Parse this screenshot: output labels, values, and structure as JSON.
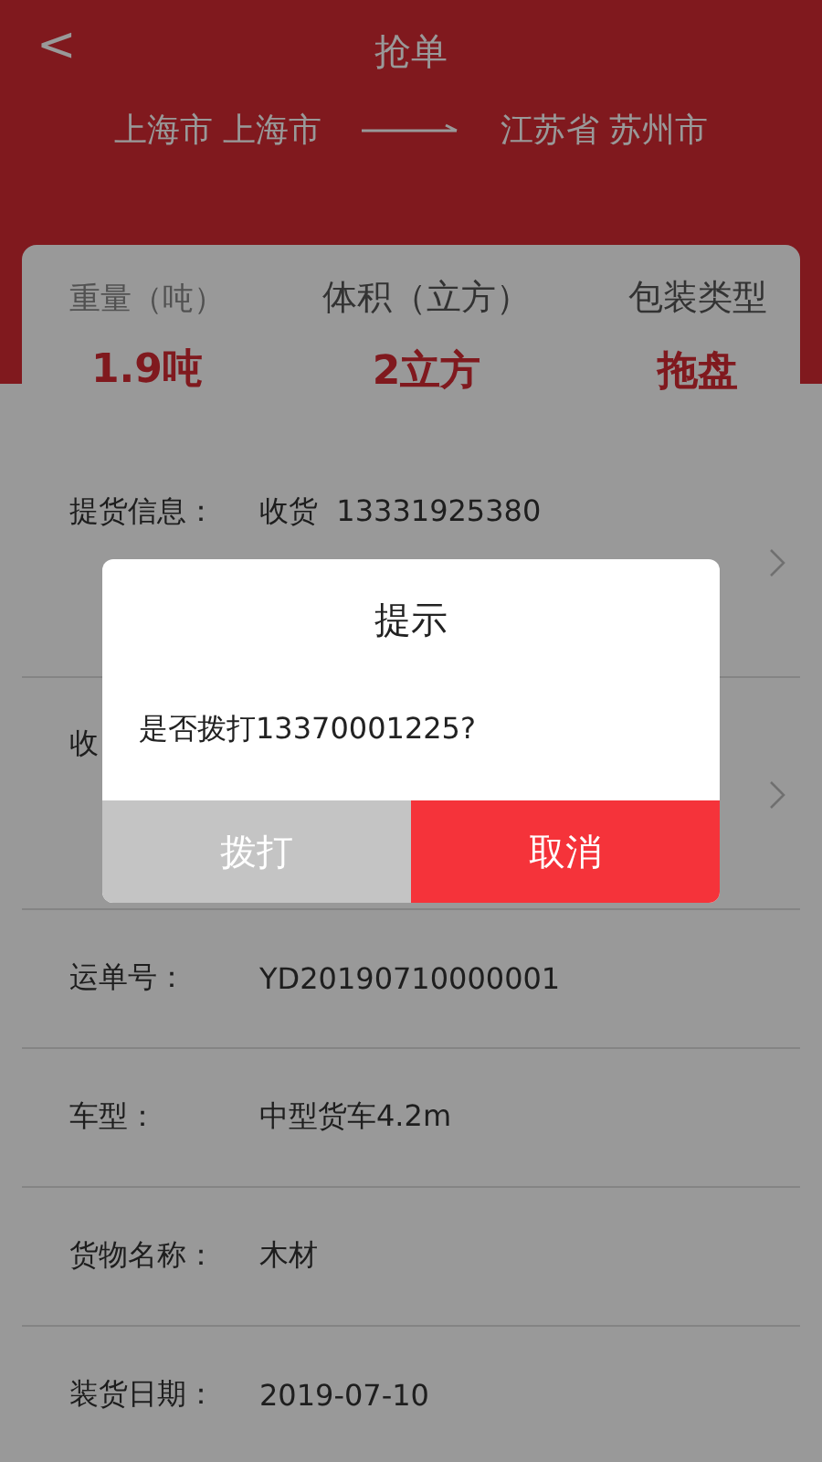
{
  "header": {
    "back": "<",
    "title": "抢单"
  },
  "route": {
    "from": "上海市 上海市",
    "to": "江苏省 苏州市"
  },
  "stats": [
    {
      "label": "重量（吨）",
      "value": "1.9吨"
    },
    {
      "label": "体积（立方）",
      "value": "2立方"
    },
    {
      "label": "包装类型",
      "value": "拖盘"
    }
  ],
  "rows": [
    {
      "kind": "contact",
      "label": "提货信息：",
      "value": "收货  13331925380"
    },
    {
      "kind": "contact",
      "label": "收"
    },
    {
      "kind": "field",
      "label": "运单号：",
      "value": "YD20190710000001"
    },
    {
      "kind": "field",
      "label": "车型：",
      "value": "中型货车4.2m"
    },
    {
      "kind": "field",
      "label": "货物名称：",
      "value": "木材"
    },
    {
      "kind": "field",
      "label": "装货日期：",
      "value": "2019-07-10"
    }
  ],
  "dialog": {
    "title": "提示",
    "message": "是否拨打13370001225?",
    "buttons": [
      {
        "label": "拨打",
        "kind": "secondary"
      },
      {
        "label": "取消",
        "kind": "primary"
      }
    ]
  }
}
